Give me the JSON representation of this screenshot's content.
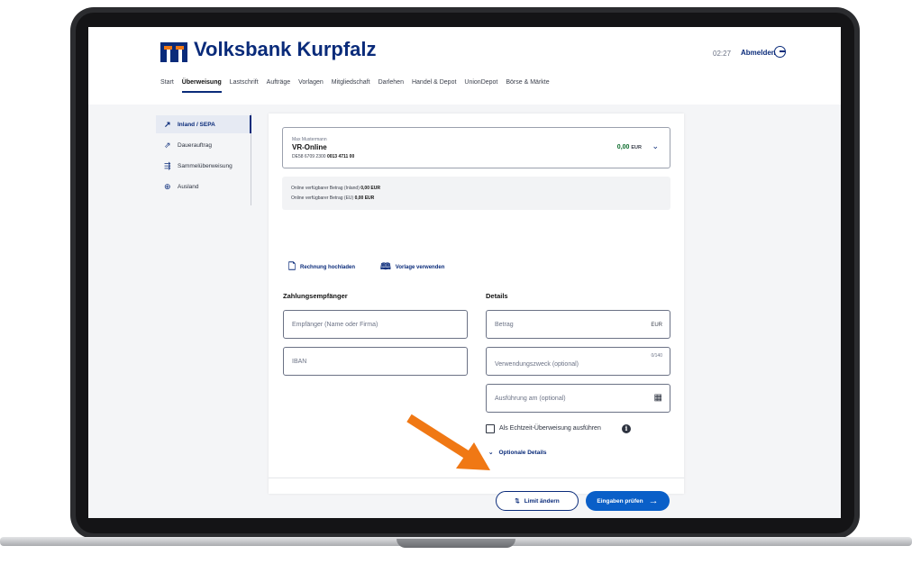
{
  "brand": {
    "name": "Volksbank Kurpfalz"
  },
  "session": {
    "timer": "02:27",
    "logout_label": "Abmelden"
  },
  "nav": {
    "items": [
      {
        "label": "Start"
      },
      {
        "label": "Überweisung",
        "active": true
      },
      {
        "label": "Lastschrift"
      },
      {
        "label": "Aufträge"
      },
      {
        "label": "Vorlagen"
      },
      {
        "label": "Mitgliedschaft"
      },
      {
        "label": "Darlehen"
      },
      {
        "label": "Handel & Depot"
      },
      {
        "label": "UnionDepot"
      },
      {
        "label": "Börse & Märkte"
      }
    ]
  },
  "sidebar": {
    "items": [
      {
        "label": "Inland / SEPA",
        "icon": "arrow-up-right-icon",
        "active": true
      },
      {
        "label": "Dauerauftrag",
        "icon": "repeat-arrow-icon"
      },
      {
        "label": "Sammelüberweisung",
        "icon": "multi-arrow-icon"
      },
      {
        "label": "Ausland",
        "icon": "globe-arrow-icon"
      }
    ]
  },
  "account": {
    "owner": "Max Mustermann",
    "name": "VR-Online",
    "iban_prefix": "DE58 6709 2300",
    "iban_suffix": "0013 4711 00",
    "balance": "0,00",
    "currency": "EUR"
  },
  "availability": {
    "inland_label": "Online verfügbarer Betrag (Inland)",
    "inland_value": "0,00 EUR",
    "eu_label": "Online verfügbarer Betrag (EU)",
    "eu_value": "0,00 EUR"
  },
  "actions": {
    "upload_invoice": "Rechnung hochladen",
    "use_template": "Vorlage verwenden"
  },
  "recipient": {
    "title": "Zahlungsempfänger",
    "name_placeholder": "Empfänger (Name oder Firma)",
    "iban_placeholder": "IBAN"
  },
  "details": {
    "title": "Details",
    "amount_placeholder": "Betrag",
    "amount_suffix": "EUR",
    "purpose_placeholder": "Verwendungszweck (optional)",
    "purpose_counter": "0/140",
    "date_placeholder": "Ausführung am (optional)",
    "realtime_label": "Als Echtzeit-Überweisung ausführen",
    "optional_details": "Optionale Details"
  },
  "footer": {
    "limit_button": "Limit ändern",
    "submit_button": "Eingaben prüfen"
  },
  "colors": {
    "brand_blue": "#0a2b7a",
    "primary_button": "#0a5fc8",
    "highlight_arrow": "#f07814",
    "balance_green": "#0a6b2b"
  }
}
